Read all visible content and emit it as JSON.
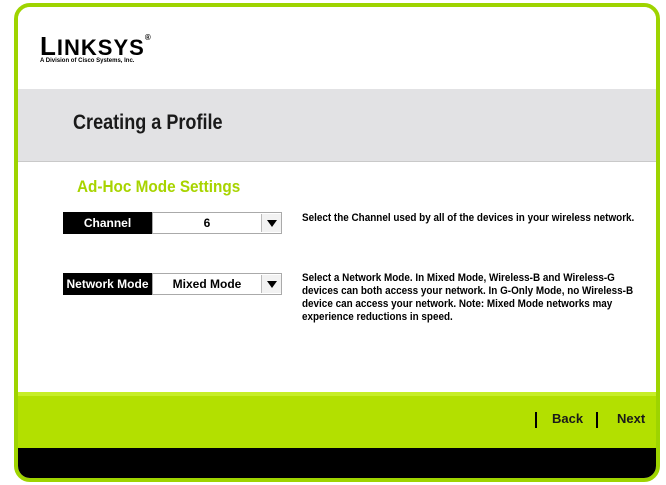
{
  "brand": {
    "name_first": "L",
    "name_rest": "INKSYS",
    "registered": "®",
    "subtitle": "A Division of Cisco Systems, Inc."
  },
  "page": {
    "title": "Creating a Profile",
    "section_title": "Ad-Hoc Mode Settings"
  },
  "channel": {
    "label": "Channel",
    "value": "6",
    "description": "Select the Channel used by all of the devices in your wireless network."
  },
  "network_mode": {
    "label": "Network Mode",
    "value": "Mixed Mode",
    "desc_1": "Select a Network Mode. In ",
    "desc_bold_1": "Mixed Mode",
    "desc_2": ", Wireless-B and Wireless-G devices can both access your network. In ",
    "desc_bold_2": "G-Only Mode",
    "desc_3": ", no Wireless-B device can access your network. Note: Mixed Mode networks may experience reductions in speed."
  },
  "nav": {
    "back": "Back",
    "next": "Next"
  },
  "colors": {
    "accent": "#a8d400",
    "footer": "#b3e000",
    "title_band": "#e2e2e4"
  }
}
